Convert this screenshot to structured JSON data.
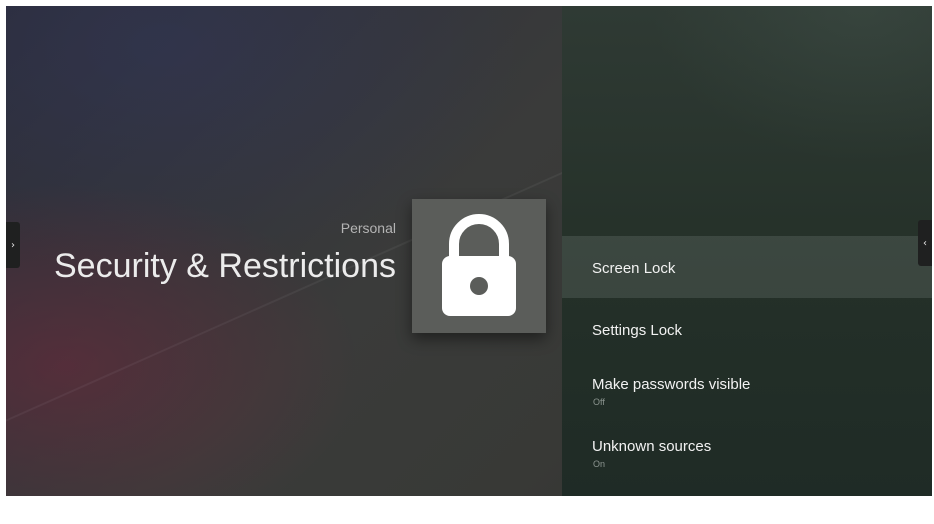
{
  "header": {
    "category": "Personal",
    "title": "Security & Restrictions",
    "icon": "lock-icon"
  },
  "navigation": {
    "left_arrow": "›",
    "right_arrow": "‹"
  },
  "menu": {
    "items": [
      {
        "label": "Screen Lock",
        "value": "",
        "selected": true
      },
      {
        "label": "Settings Lock",
        "value": ""
      },
      {
        "label": "Make passwords visible",
        "value": "Off"
      },
      {
        "label": "Unknown sources",
        "value": "On"
      }
    ]
  },
  "colors": {
    "tile": "#5b5d5a",
    "icon": "#ffffff",
    "panel": "#243028",
    "selected_row": "#4a524e"
  }
}
